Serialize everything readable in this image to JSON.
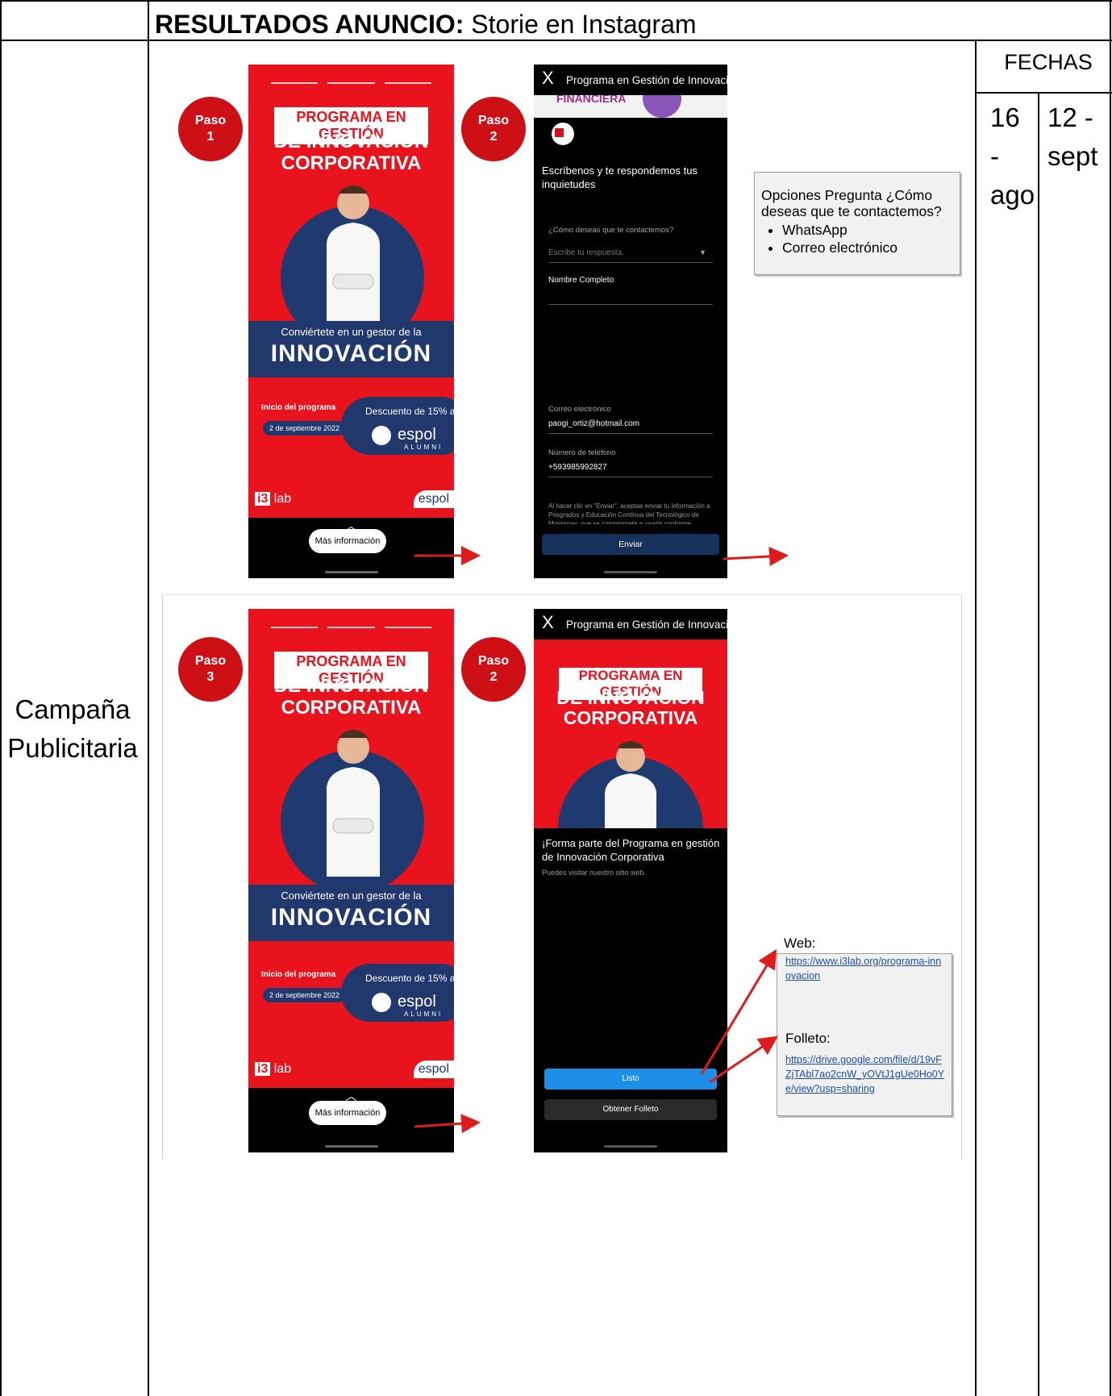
{
  "header": {
    "title_bold": "RESULTADOS ANUNCIO:",
    "title_rest": " Storie en Instagram"
  },
  "dates": {
    "label": "FECHAS",
    "start": [
      "16",
      "-",
      "ago"
    ],
    "end": [
      "12 -",
      "sept"
    ]
  },
  "row_label": [
    "Campaña",
    "Publicitaria"
  ],
  "story": {
    "program_label": "PROGRAMA EN GESTIÓN",
    "program_big": [
      "DE INNOVACIÓN",
      "CORPORATIVA"
    ],
    "band_small": "Conviértete en un gestor de la",
    "band_big": "INNOVACIÓN",
    "inicio": "Inicio del programa",
    "fecha": "2 de septiembre 2022",
    "descuento": "Descuento de 15% a",
    "espol": "espol",
    "alumni": "ALUMNI",
    "i3": "i3",
    "lab": "lab",
    "mas_info": "Más información"
  },
  "badges": [
    {
      "word": "Paso",
      "num": "1"
    },
    {
      "word": "Paso",
      "num": "2"
    },
    {
      "word": "Paso",
      "num": "3"
    },
    {
      "word": "Paso",
      "num": "2"
    }
  ],
  "form_screen": {
    "close": "X",
    "title": "Programa en Gestión de Innovació",
    "strip_text": "FINANCIERA",
    "intro": [
      "Escríbenos y te respondemos tus",
      "inquietudes"
    ],
    "q_label": "¿Cómo deseas que te contactemos?",
    "q_placeholder": "Escribe tu respuesta.",
    "name_label": "Nombre Completo",
    "email_label": "Correo electrónico",
    "email_value": "paogi_ortiz@hotmail.com",
    "phone_label": "Número de teléfono",
    "phone_value": "+593985992827",
    "legal": "Al hacer clic en \"Enviar\", aceptas enviar tu información a Posgrados y Educación Continua del Tecnológico de Monterrey, que se compromete a usarla conforme",
    "send": "Enviar"
  },
  "thanks_screen": {
    "close": "X",
    "title": "Programa en Gestión de Innovació",
    "program_label": "PROGRAMA EN GESTIÓN",
    "program_big": [
      "DE INNOVACIÓN",
      "CORPORATIVA"
    ],
    "forma": [
      "¡Forma parte del Programa en gestión",
      "de Innovación Corporativa"
    ],
    "visit": "Puedes visitar nuestro sitio web.",
    "listo": "Listo",
    "folleto": "Obtener Folleto"
  },
  "callout_options": {
    "heading": [
      "Opciones Pregunta ¿Cómo",
      "deseas que te contactemos?"
    ],
    "options": [
      "WhatsApp",
      "Correo electrónico"
    ]
  },
  "callout_links": {
    "web_label": "Web:",
    "web_url": "https://www.i3lab.org/programa-innovacion",
    "folleto_label": "Folleto:",
    "folleto_url": "https://drive.google.com/file/d/19vFZjTAbl7ao2cnW_yOVtJ1gUe0Ho0Ye/view?usp=sharing"
  },
  "colors": {
    "red": "#e8131c",
    "navy": "#20386c",
    "badge": "#cc1016",
    "arrow": "#e01b1b",
    "link": "#1c4fa8",
    "button_blue": "#1d8fe6"
  }
}
